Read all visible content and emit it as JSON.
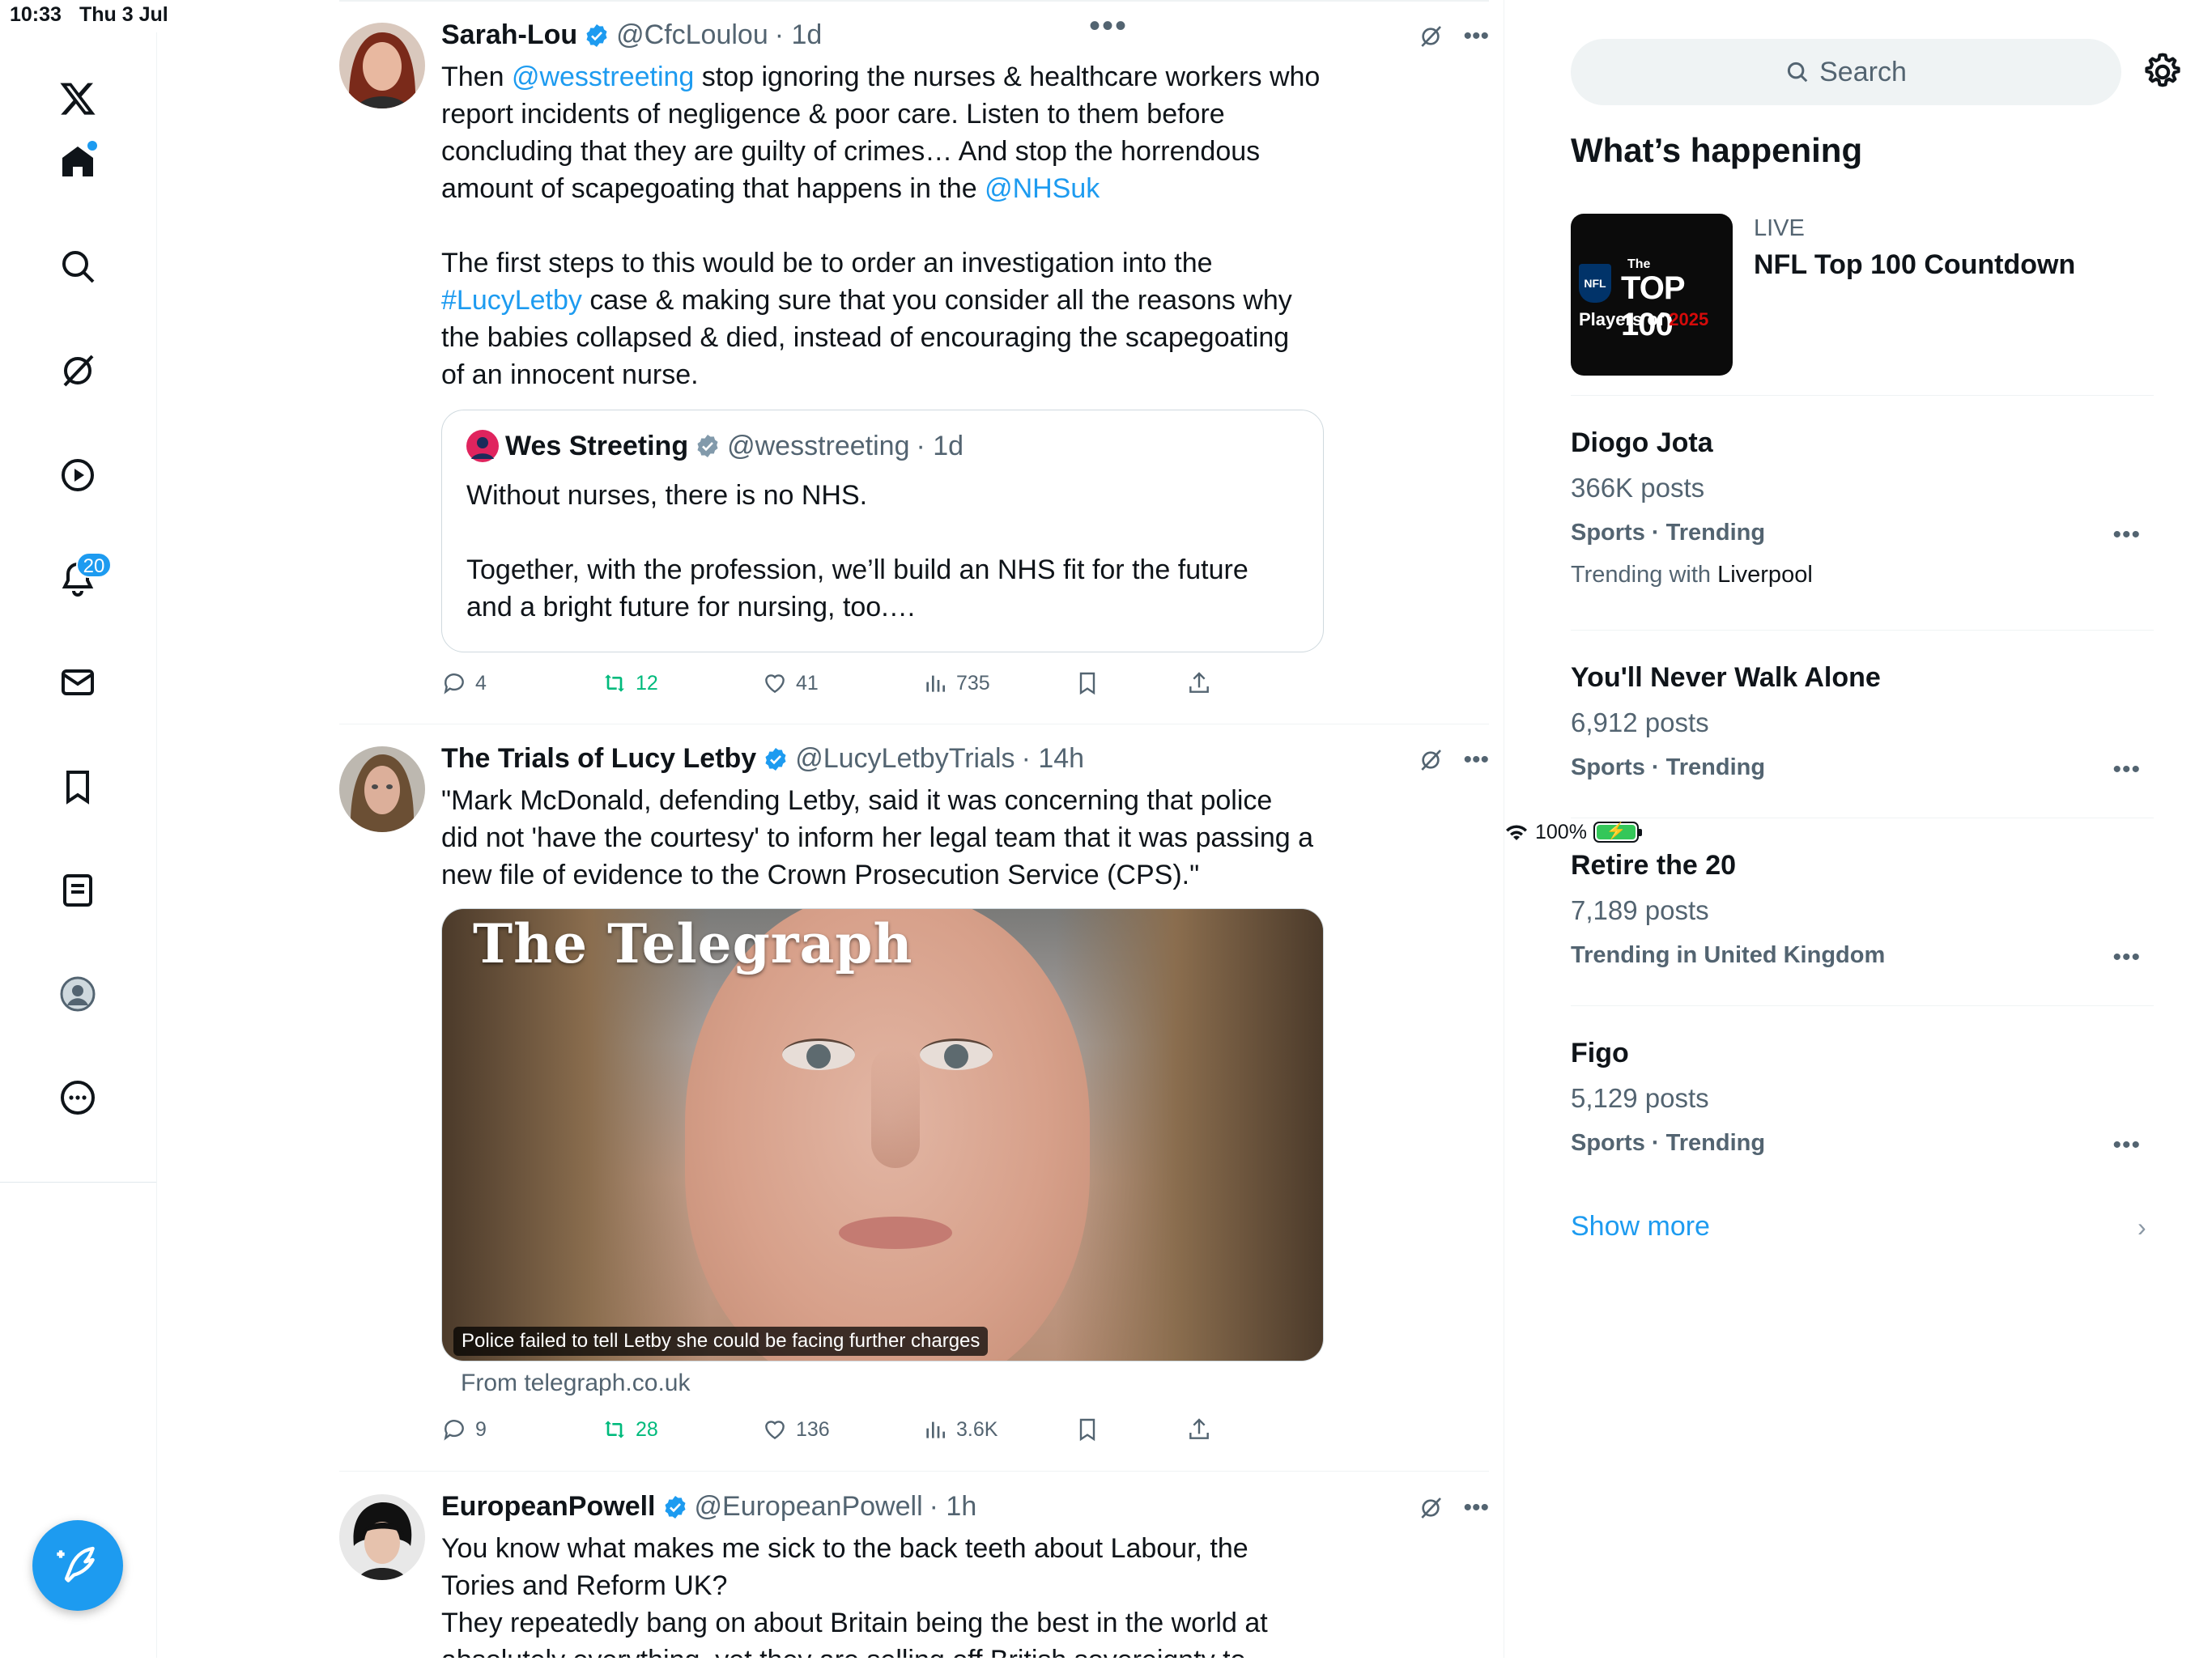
{
  "status_bar": {
    "time": "10:33",
    "date": "Thu 3 Jul",
    "battery": "100%"
  },
  "nav": {
    "notifications_badge": "20"
  },
  "posts": [
    {
      "name": "Sarah-Lou",
      "handle": "@CfcLoulou",
      "time": "· 1d",
      "body_lines": [
        {
          "parts": [
            {
              "t": "Then "
            },
            {
              "t": "@wesstreeting",
              "link": true
            },
            {
              "t": " stop ignoring the nurses & healthcare workers who"
            }
          ]
        },
        {
          "parts": [
            {
              "t": "report incidents of negligence & poor care.  Listen to them before"
            }
          ]
        },
        {
          "parts": [
            {
              "t": "concluding that they are guilty of crimes… And stop the horrendous"
            }
          ]
        },
        {
          "parts": [
            {
              "t": "amount of scapegoating that happens in the "
            },
            {
              "t": "@NHSuk",
              "link": true
            }
          ]
        },
        {
          "parts": [
            {
              "t": ""
            }
          ]
        },
        {
          "parts": [
            {
              "t": "The first steps to this would be to order an investigation into the"
            }
          ]
        },
        {
          "parts": [
            {
              "t": "#LucyLetby",
              "link": true
            },
            {
              "t": " case & making sure that you consider all the reasons why"
            }
          ]
        },
        {
          "parts": [
            {
              "t": "the babies collapsed & died, instead of encouraging the scapegoating"
            }
          ]
        },
        {
          "parts": [
            {
              "t": "of an innocent nurse."
            }
          ]
        }
      ],
      "quote": {
        "name": "Wes Streeting",
        "handle": "@wesstreeting",
        "time": "· 1d",
        "line1": "Without nurses, there is no NHS.",
        "line2": "Together, with the profession, we’ll build an NHS fit for the future",
        "line3": "and a bright future for nursing, too.…"
      },
      "replies": "4",
      "reposts": "12",
      "likes": "41",
      "views": "735"
    },
    {
      "name": "The Trials of Lucy Letby",
      "handle": "@LucyLetbyTrials",
      "time": "· 14h",
      "body_lines": [
        {
          "parts": [
            {
              "t": "\"Mark McDonald, defending Letby, said it was concerning that police"
            }
          ]
        },
        {
          "parts": [
            {
              "t": "did not 'have the courtesy' to inform her legal team that it was passing a"
            }
          ]
        },
        {
          "parts": [
            {
              "t": "new file of evidence to the Crown Prosecution Service (CPS).\""
            }
          ]
        }
      ],
      "media": {
        "masthead": "The Telegraph",
        "caption": "Police failed to tell Letby she could be facing further charges",
        "from": "From telegraph.co.uk"
      },
      "replies": "9",
      "reposts": "28",
      "likes": "136",
      "views": "3.6K"
    },
    {
      "name": "EuropeanPowell",
      "handle": "@EuropeanPowell",
      "time": "· 1h",
      "body_lines": [
        {
          "parts": [
            {
              "t": "You know what makes me sick to the back teeth about Labour, the"
            }
          ]
        },
        {
          "parts": [
            {
              "t": "Tories and Reform UK?"
            }
          ]
        },
        {
          "parts": [
            {
              "t": "They repeatedly bang on about Britain being the best in the world at"
            }
          ]
        },
        {
          "parts": [
            {
              "t": "absolutely everything, yet they are selling off British sovereignty to"
            }
          ]
        }
      ]
    }
  ],
  "sidebar": {
    "search_placeholder": "Search",
    "title": "What’s happening",
    "live": {
      "label": "LIVE",
      "title": "NFL Top 100 Countdown",
      "img_line1": "The",
      "img_line2": "TOP 100",
      "img_line3a": "Players of ",
      "img_line3b": "2025",
      "img_badge": "NFL"
    },
    "trends": [
      {
        "name": "Diogo Jota",
        "posts": "366K posts",
        "category": "Sports · Trending",
        "with_label": "Trending with ",
        "with_value": "Liverpool"
      },
      {
        "name": "You'll Never Walk Alone",
        "posts": "6,912 posts",
        "category": "Sports · Trending"
      },
      {
        "name": "Retire the 20",
        "posts": "7,189 posts",
        "category": "Trending in United Kingdom"
      },
      {
        "name": "Figo",
        "posts": "5,129 posts",
        "category": "Sports · Trending"
      }
    ],
    "show_more": "Show more"
  },
  "colors": {
    "accent": "#1d9bf0",
    "repost_green": "#00ba7c",
    "text": "#0f1419",
    "muted": "#536471"
  }
}
